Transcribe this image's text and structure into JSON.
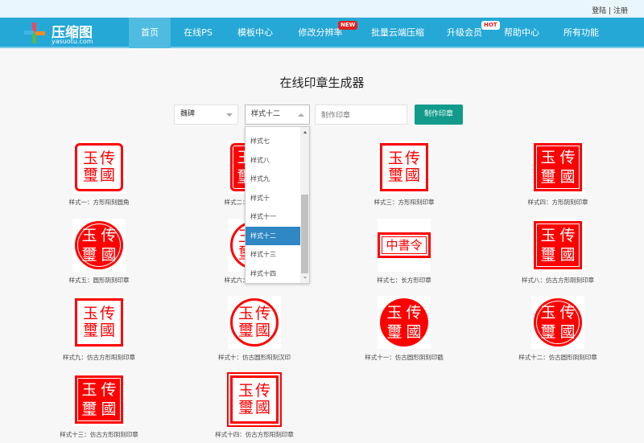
{
  "topbar": {
    "login": "登陆",
    "sep": "|",
    "register": "注册"
  },
  "logo": {
    "name": "压缩图",
    "domain": "yasuotu.com"
  },
  "nav": {
    "items": [
      {
        "label": "首页",
        "active": true
      },
      {
        "label": "在线PS"
      },
      {
        "label": "模板中心"
      },
      {
        "label": "修改分辨率",
        "badge": "NEW"
      },
      {
        "label": "批量云端压缩"
      },
      {
        "label": "升级会员",
        "badge": "HOT"
      },
      {
        "label": "帮助中心"
      },
      {
        "label": "所有功能"
      }
    ]
  },
  "page": {
    "title": "在线印章生成器"
  },
  "controls": {
    "font_select": "魏碑",
    "style_select": "样式十二",
    "text_input_placeholder": "制作印章",
    "make_button": "制作印章"
  },
  "dropdown": {
    "options": [
      "样式七",
      "样式八",
      "样式九",
      "样式十",
      "样式十一",
      "样式十二",
      "样式十三",
      "样式十四"
    ],
    "selected": "样式十二"
  },
  "stamp_text": [
    "玉",
    "传",
    "璽",
    "國"
  ],
  "stamp_text_rect": "中書令",
  "colors": {
    "nav": "#25a8d6",
    "button": "#129b8b",
    "stamp": "#ff0000",
    "selected_option": "#2f87c4"
  },
  "stamps": [
    {
      "caption": "样式一：方形阳刻圆角",
      "kind": "sq-yang-round"
    },
    {
      "caption": "样式二：方形阴刻圆角",
      "kind": "sq-yin-round"
    },
    {
      "caption": "样式三：方形阳刻印章",
      "kind": "sq-yang"
    },
    {
      "caption": "样式四：方形阴刻印章",
      "kind": "sq-yin"
    },
    {
      "caption": "样式五：圆形阴刻印章",
      "kind": "circ-yin"
    },
    {
      "caption": "样式六：圆形阳刻印章",
      "kind": "circ-yang"
    },
    {
      "caption": "样式七：长方形印章",
      "kind": "rect"
    },
    {
      "caption": "样式八：仿古方形阴刻印章",
      "kind": "sq-yin-old"
    },
    {
      "caption": "样式九：仿古方形阳刻印章",
      "kind": "sq-yang-old"
    },
    {
      "caption": "样式十：仿古圆形阳刻汉印",
      "kind": "circ-yang"
    },
    {
      "caption": "样式十一：仿古圆形阴刻印戳",
      "kind": "circ-yin-plain"
    },
    {
      "caption": "样式十二：仿古圆形阴刻印章",
      "kind": "circ-yin"
    },
    {
      "caption": "样式十三：仿古方形阴刻印章",
      "kind": "sq-yin-old"
    },
    {
      "caption": "样式十四：仿古方形阳刻印章",
      "kind": "sq-yang-frame"
    }
  ]
}
